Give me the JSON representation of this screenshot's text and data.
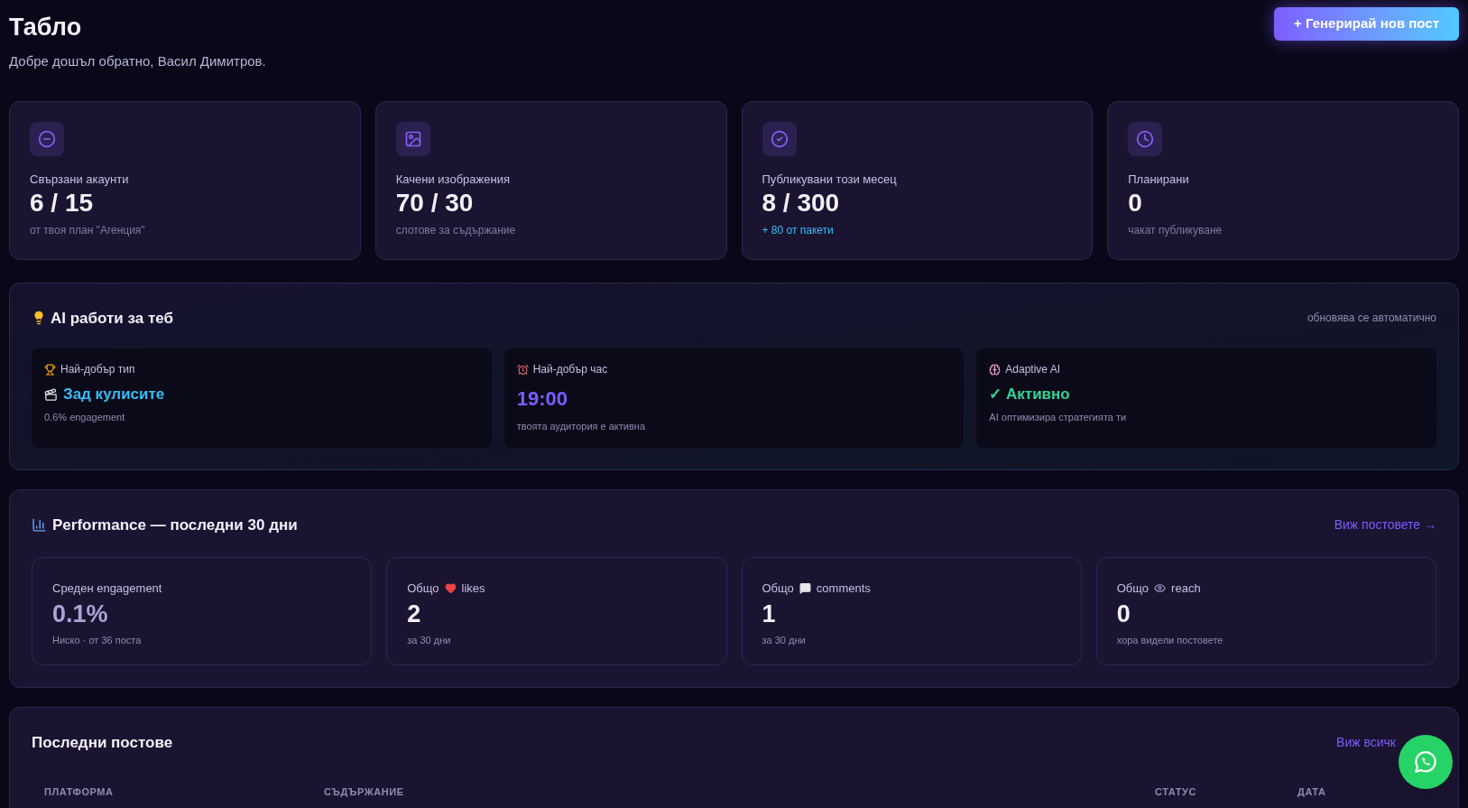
{
  "header": {
    "title": "Табло",
    "subtitle": "Добре дошъл обратно, Васил Димитров.",
    "action": "+ Генерирай нов пост"
  },
  "stats": [
    {
      "kind": "accounts",
      "label": "Свързани акаунти",
      "value": "6 / 15",
      "note": "от твоя план \"Агенция\"",
      "highlight": false
    },
    {
      "kind": "images",
      "label": "Качени изображения",
      "value": "70 / 30",
      "note": "слотове за съдържание",
      "highlight": false
    },
    {
      "kind": "published",
      "label": "Публикувани този месец",
      "value": "8 / 300",
      "note": "+ 80 от пакети",
      "highlight": true
    },
    {
      "kind": "scheduled",
      "label": "Планирани",
      "value": "0",
      "note": "чакат публикуване",
      "highlight": false
    }
  ],
  "ai": {
    "title": "AI работи за теб",
    "hint": "обновява се автоматично",
    "cards": [
      {
        "kind": "type",
        "label": "Най-добър тип",
        "value": "Зад кулисите",
        "note": "0.6% engagement",
        "color": "#38bdf8"
      },
      {
        "kind": "time",
        "label": "Най-добър час",
        "value": "19:00",
        "note": "твоята аудитория е активна",
        "color": "#7c5cff"
      },
      {
        "kind": "adaptive",
        "label": "Adaptive AI",
        "value": "✓ Активно",
        "note": "AI оптимизира стратегията ти",
        "color": "#34d399"
      }
    ]
  },
  "performance": {
    "title": "Performance — последни 30 дни",
    "link": "Виж постовете →",
    "metrics": [
      {
        "label": "Среден engagement",
        "value": "0.1%",
        "note": "Ниско · от 36 поста",
        "dimmed": true
      },
      {
        "kind": "likes",
        "label_before": "Общо",
        "label_after": "likes",
        "value": "2",
        "note": "за 30 дни",
        "dimmed": false
      },
      {
        "kind": "comments",
        "label_before": "Общо",
        "label_after": "comments",
        "value": "1",
        "note": "за 30 дни",
        "dimmed": false
      },
      {
        "kind": "reach",
        "label_before": "Общо",
        "label_after": "reach",
        "value": "0",
        "note": "хора видели постовете",
        "dimmed": false
      }
    ]
  },
  "recent": {
    "title": "Последни постове",
    "link": "Виж всичк",
    "columns": [
      "ПЛАТФОРМА",
      "СЪДЪРЖАНИЕ",
      "СТАТУС",
      "ДАТА"
    ]
  }
}
